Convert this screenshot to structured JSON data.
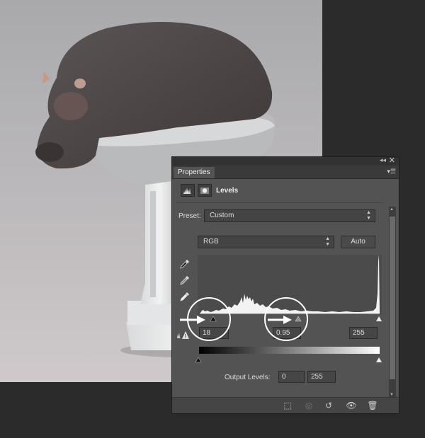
{
  "panel": {
    "tab_label": "Properties",
    "title": "Levels",
    "collapse_icon": "double-chevron-icon",
    "close_icon": "close-icon",
    "menu_icon": "panel-menu-icon"
  },
  "preset": {
    "label": "Preset:",
    "value": "Custom"
  },
  "channel": {
    "value": "RGB"
  },
  "auto_button": "Auto",
  "input_levels": {
    "black": "18",
    "gamma": "0.95",
    "white": "255"
  },
  "output_levels": {
    "label": "Output Levels:",
    "black": "0",
    "white": "255"
  },
  "colors": {
    "panel_bg": "#535353",
    "panel_border": "#1e1e1e",
    "annotation": "#ffffff"
  }
}
